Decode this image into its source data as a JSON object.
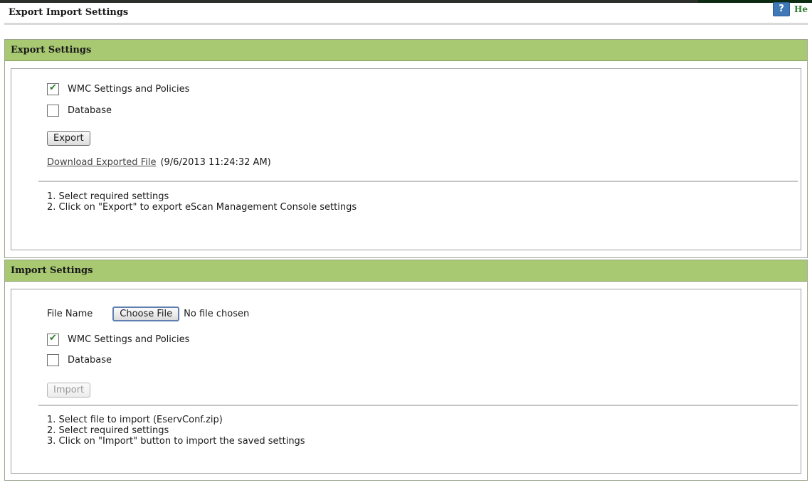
{
  "page": {
    "title": "Export Import Settings",
    "help_label": "He",
    "help_icon_glyph": "?"
  },
  "export": {
    "header": "Export Settings",
    "option_wmc": {
      "label": "WMC Settings and Policies",
      "checked": true
    },
    "option_db": {
      "label": "Database",
      "checked": false
    },
    "export_button": "Export",
    "download_link": "Download Exported File",
    "download_timestamp": "(9/6/2013 11:24:32 AM)",
    "notes": [
      "1. Select required settings",
      "2. Click on \"Export\" to export eScan Management Console settings"
    ]
  },
  "import": {
    "header": "Import Settings",
    "file_label": "File Name",
    "choose_file_button": "Choose File",
    "file_status": "No file chosen",
    "option_wmc": {
      "label": "WMC Settings and Policies",
      "checked": true
    },
    "option_db": {
      "label": "Database",
      "checked": false
    },
    "import_button": "Import",
    "notes": [
      "1. Select file to import (EservConf.zip)",
      "2. Select required settings",
      "3. Click on \"Import\" button to import the saved settings"
    ]
  },
  "colors": {
    "section_header_bg": "#a8c871",
    "help_icon_bg": "#3f79b8",
    "help_text": "#2e7d2e",
    "checkmark": "#2a7a2a"
  },
  "icons": {
    "help": "help-icon",
    "checkbox_checked": "checkbox-checked-icon",
    "checkbox_unchecked": "checkbox-unchecked-icon"
  }
}
